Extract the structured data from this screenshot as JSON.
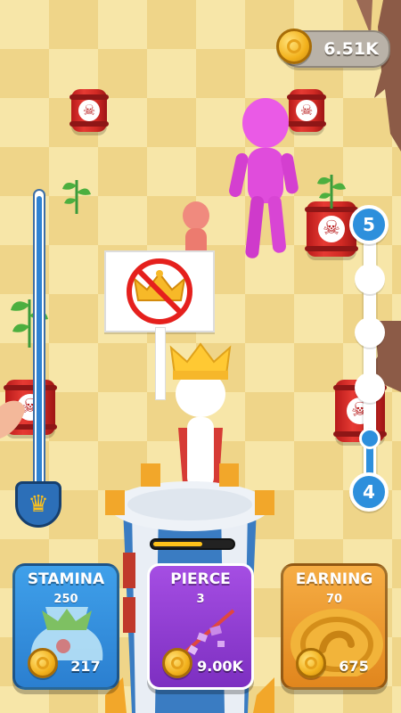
{
  "hud": {
    "coins": "6.51K",
    "coin_icon": "coin-icon"
  },
  "protest_sign": {
    "icon": "no-crown-icon"
  },
  "progress": {
    "fill_fraction": 1.0,
    "badge_icon": "crown-icon"
  },
  "levels": {
    "next": "5",
    "current": "4",
    "progress_fraction": 0.15
  },
  "stamina_bar": {
    "fill_fraction": 0.6
  },
  "upgrades": [
    {
      "title": "STAMINA",
      "level": "250",
      "price": "217",
      "color": "#2b7fd0"
    },
    {
      "title": "PIERCE",
      "level": "3",
      "price": "9.00K",
      "color": "#8a3ad0"
    },
    {
      "title": "EARNING",
      "level": "70",
      "price": "675",
      "color": "#e8922a"
    }
  ],
  "colors": {
    "floor_light": "#f7e6a8",
    "floor_dark": "#efd589",
    "enemy": "#e64fe0",
    "barrel": "#d12a24",
    "track": "#2f82d2"
  }
}
